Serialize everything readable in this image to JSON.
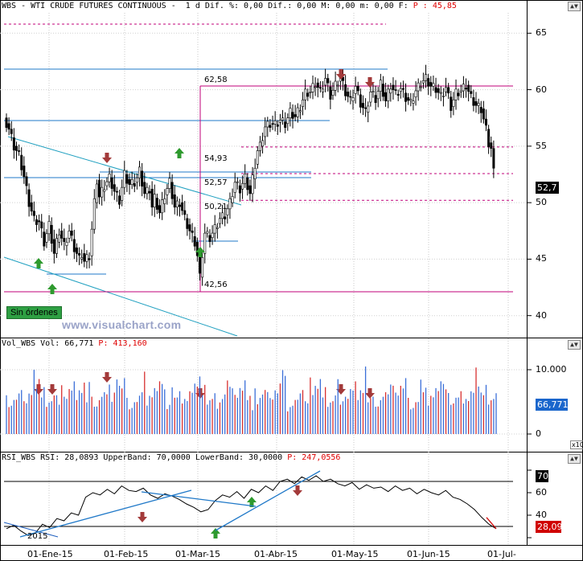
{
  "price_pane": {
    "title_prefix": "WBS - WTI CRUDE FUTURES CONTINUOUS -  1 d Dif. %: 0,00 Dif.: 0,00 M: 0,00 m: 0,00 F: ",
    "title_red": "P : 45,85",
    "last_value": "52,7",
    "sin_ordenes": "Sin órdenes",
    "watermark": "www.visualchart.com",
    "price_labels": [
      "62,58",
      "54,93",
      "52,57",
      "50,21",
      "42,56"
    ]
  },
  "volume_pane": {
    "title_prefix": "Vol_WBS Vol: 66,771 ",
    "title_red": "P: 413,160",
    "last_value": "66,771",
    "scale_note": "x10"
  },
  "rsi_pane": {
    "title_prefix": "RSI_WBS RSI: 28,0893 UpperBand: 70,0000 LowerBand: 30,0000 ",
    "title_red": "P: 247,0556",
    "upper_value": "70",
    "last_value": "28,09",
    "year_label": "2015"
  },
  "x_axis_labels": [
    "01-Ene-15",
    "01-Feb-15",
    "01-Mar-15",
    "01-Abr-15",
    "01-May-15",
    "01-Jun-15",
    "01-Jul-"
  ],
  "colors": {
    "up_arrow": "#2e9a2e",
    "down_arrow": "#a33a3a",
    "trend_line": "#1f78c8",
    "fib_line": "#c0007a",
    "volume_bar_up": "#3b6fd8",
    "volume_bar_down": "#d83030",
    "last_badge_blue": "#1a66cc",
    "last_badge_black": "#000000",
    "last_badge_red": "#d00000"
  },
  "chart_data": [
    {
      "type": "candlestick",
      "title": "WTI CRUDE FUTURES CONTINUOUS",
      "y_ticks": [
        40,
        45,
        50,
        55,
        60,
        65
      ],
      "ylim": [
        38.2,
        66.8
      ],
      "x_ticks": [
        "01-Ene-15",
        "01-Feb-15",
        "01-Mar-15",
        "01-Abr-15",
        "01-May-15",
        "01-Jun-15",
        "01-Jul-"
      ],
      "close_path": [
        [
          0,
          57.5
        ],
        [
          2,
          56.5
        ],
        [
          4,
          55
        ],
        [
          6,
          54.2
        ],
        [
          8,
          52.3
        ],
        [
          10,
          50
        ],
        [
          12,
          48.5
        ],
        [
          14,
          48.3
        ],
        [
          16,
          46.5
        ],
        [
          18,
          48
        ],
        [
          20,
          45.5
        ],
        [
          22,
          47.5
        ],
        [
          24,
          46.2
        ],
        [
          26,
          47.5
        ],
        [
          28,
          46
        ],
        [
          30,
          45
        ],
        [
          31,
          45.5
        ],
        [
          32,
          44.8
        ],
        [
          34,
          45.3
        ],
        [
          36,
          50
        ],
        [
          37,
          52
        ],
        [
          38,
          50.5
        ],
        [
          40,
          51.5
        ],
        [
          42,
          52.2
        ],
        [
          44,
          51
        ],
        [
          46,
          50.2
        ],
        [
          48,
          52.5
        ],
        [
          50,
          51.6
        ],
        [
          52,
          51.8
        ],
        [
          53,
          52.2
        ],
        [
          54,
          52.8
        ],
        [
          56,
          50.8
        ],
        [
          58,
          51.2
        ],
        [
          59,
          49.6
        ],
        [
          60,
          50.4
        ],
        [
          62,
          49.1
        ],
        [
          64,
          50.7
        ],
        [
          66,
          51.8
        ],
        [
          68,
          49.6
        ],
        [
          70,
          50
        ],
        [
          72,
          48.6
        ],
        [
          74,
          47.5
        ],
        [
          76,
          46.5
        ],
        [
          77,
          45.3
        ],
        [
          78,
          43.4
        ],
        [
          79,
          45.5
        ],
        [
          80,
          47.3
        ],
        [
          82,
          46.9
        ],
        [
          84,
          47.7
        ],
        [
          86,
          48.6
        ],
        [
          88,
          48.9
        ],
        [
          90,
          50
        ],
        [
          92,
          51.8
        ],
        [
          94,
          51.2
        ],
        [
          96,
          52.2
        ],
        [
          98,
          50.8
        ],
        [
          100,
          53.4
        ],
        [
          101,
          54.6
        ],
        [
          102,
          55
        ],
        [
          104,
          56.7
        ],
        [
          106,
          57
        ],
        [
          108,
          56.9
        ],
        [
          110,
          57.3
        ],
        [
          112,
          57
        ],
        [
          114,
          58
        ],
        [
          116,
          57.6
        ],
        [
          118,
          58.5
        ],
        [
          120,
          59.7
        ],
        [
          122,
          59.8
        ],
        [
          124,
          60.6
        ],
        [
          126,
          59.8
        ],
        [
          128,
          61
        ],
        [
          130,
          59.5
        ],
        [
          132,
          60.4
        ],
        [
          134,
          61.1
        ],
        [
          136,
          59.8
        ],
        [
          138,
          59
        ],
        [
          140,
          60.3
        ],
        [
          142,
          58.8
        ],
        [
          144,
          58
        ],
        [
          146,
          59.8
        ],
        [
          148,
          59.2
        ],
        [
          150,
          60.5
        ],
        [
          152,
          59
        ],
        [
          154,
          60.4
        ],
        [
          156,
          59.6
        ],
        [
          158,
          60.1
        ],
        [
          160,
          59.3
        ],
        [
          162,
          58.8
        ],
        [
          164,
          59.9
        ],
        [
          166,
          60.6
        ],
        [
          168,
          61
        ],
        [
          170,
          60.3
        ],
        [
          172,
          60.1
        ],
        [
          174,
          59.4
        ],
        [
          176,
          60.2
        ],
        [
          178,
          58.5
        ],
        [
          180,
          59.7
        ],
        [
          182,
          59.9
        ],
        [
          184,
          60.4
        ],
        [
          186,
          59.3
        ],
        [
          188,
          58.6
        ],
        [
          190,
          58.3
        ],
        [
          192,
          56.5
        ],
        [
          193,
          55.3
        ],
        [
          194,
          54.8
        ],
        [
          195,
          52.7
        ]
      ],
      "horizontal_levels": [
        62.58,
        54.93,
        52.57,
        50.21,
        42.56
      ],
      "last_value": 52.7
    },
    {
      "type": "bar",
      "title": "Vol_WBS",
      "ylim": [
        0,
        13
      ],
      "y_ticks": [
        0,
        10
      ],
      "values": [
        4.5,
        5.2,
        4.9,
        6.1,
        5.4,
        6.8,
        7.2,
        8.0,
        6.5,
        9.1,
        7.8,
        10.2,
        8.4,
        11.0,
        9.3,
        12.1
      ],
      "last_value": 6.6771
    },
    {
      "type": "line",
      "title": "RSI_WBS",
      "ylim": [
        15,
        85
      ],
      "y_ticks": [
        20,
        40,
        60,
        80
      ],
      "upper_band": 70,
      "lower_band": 30,
      "values": [
        28,
        31,
        26,
        22,
        24,
        32,
        29,
        37,
        35,
        42,
        40,
        56,
        60,
        58,
        63,
        59,
        66,
        62,
        61,
        64,
        58,
        55,
        59,
        57,
        54,
        50,
        47,
        43,
        45,
        53,
        58,
        56,
        61,
        55,
        63,
        60,
        66,
        62,
        70,
        72,
        68,
        74,
        71,
        75,
        70,
        72,
        68,
        66,
        69,
        63,
        67,
        64,
        65,
        61,
        66,
        62,
        64,
        59,
        63,
        60,
        58,
        62,
        56,
        54,
        50,
        45,
        38,
        32,
        28
      ],
      "last_value": 28.09
    }
  ]
}
